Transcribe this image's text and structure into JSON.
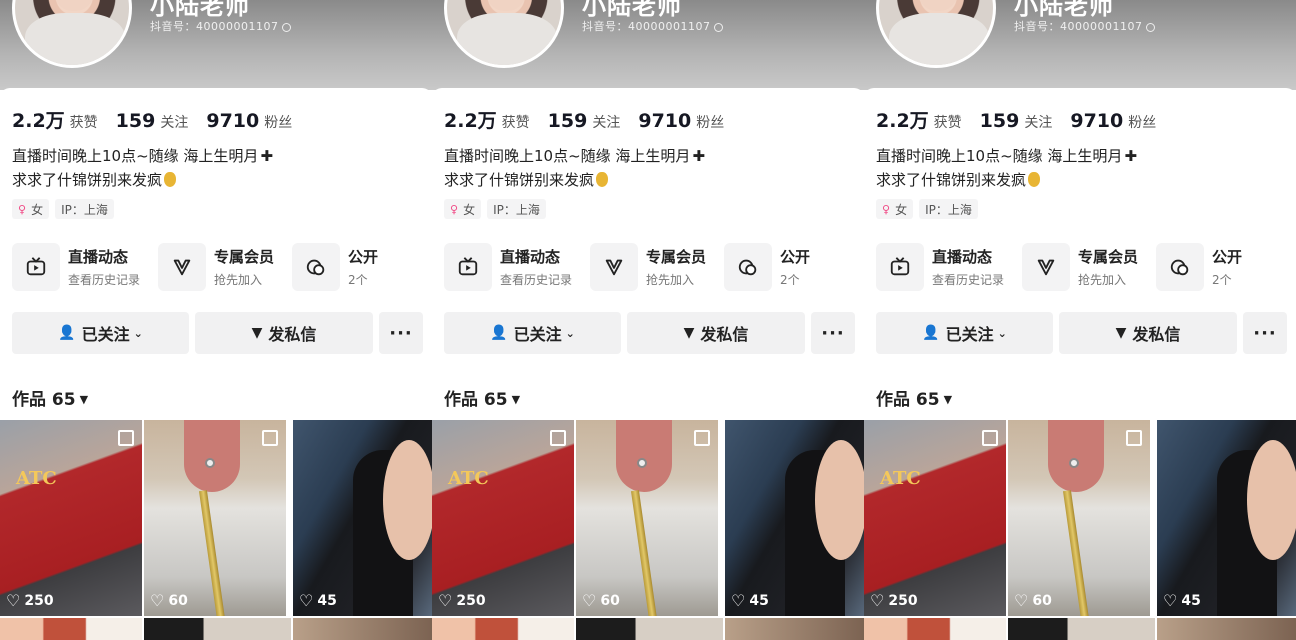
{
  "panels": [
    {
      "profile": {
        "nickname": "小陆老师",
        "douyin_id": "抖音号：40000001107"
      },
      "stats": [
        {
          "value": "2.2万",
          "label": "获赞"
        },
        {
          "value": "159",
          "label": "关注"
        },
        {
          "value": "9710",
          "label": "粉丝"
        }
      ],
      "bio": {
        "line1": "直播时间晚上10点~随缘 海上生明月",
        "line2": "求求了什锦饼别来发疯"
      },
      "tags": {
        "gender": "女",
        "ip": "IP：上海"
      },
      "services": [
        {
          "title": "直播动态",
          "subtitle": "查看历史记录"
        },
        {
          "title": "专属会员",
          "subtitle": "抢先加入"
        },
        {
          "title": "公开",
          "subtitle": "2个"
        }
      ],
      "actions": {
        "follow": "已关注",
        "message": "发私信",
        "more": "···"
      },
      "works": {
        "label": "作品 65"
      },
      "videos": [
        {
          "likes": "250",
          "overlay": "ATC"
        },
        {
          "likes": "60"
        },
        {
          "likes": "45"
        }
      ]
    },
    {
      "profile": {
        "nickname": "小陆老师",
        "douyin_id": "抖音号：40000001107"
      },
      "stats": [
        {
          "value": "2.2万",
          "label": "获赞"
        },
        {
          "value": "159",
          "label": "关注"
        },
        {
          "value": "9710",
          "label": "粉丝"
        }
      ],
      "bio": {
        "line1": "直播时间晚上10点~随缘 海上生明月",
        "line2": "求求了什锦饼别来发疯"
      },
      "tags": {
        "gender": "女",
        "ip": "IP：上海"
      },
      "services": [
        {
          "title": "直播动态",
          "subtitle": "查看历史记录"
        },
        {
          "title": "专属会员",
          "subtitle": "抢先加入"
        },
        {
          "title": "公开",
          "subtitle": "2个"
        }
      ],
      "actions": {
        "follow": "已关注",
        "message": "发私信",
        "more": "···"
      },
      "works": {
        "label": "作品 65"
      },
      "videos": [
        {
          "likes": "250",
          "overlay": "ATC"
        },
        {
          "likes": "60"
        },
        {
          "likes": "45"
        }
      ]
    },
    {
      "profile": {
        "nickname": "小陆老师",
        "douyin_id": "抖音号：40000001107"
      },
      "stats": [
        {
          "value": "2.2万",
          "label": "获赞"
        },
        {
          "value": "159",
          "label": "关注"
        },
        {
          "value": "9710",
          "label": "粉丝"
        }
      ],
      "bio": {
        "line1": "直播时间晚上10点~随缘 海上生明月",
        "line2": "求求了什锦饼别来发疯"
      },
      "tags": {
        "gender": "女",
        "ip": "IP：上海"
      },
      "services": [
        {
          "title": "直播动态",
          "subtitle": "查看历史记录"
        },
        {
          "title": "专属会员",
          "subtitle": "抢先加入"
        },
        {
          "title": "公开",
          "subtitle": "2个"
        }
      ],
      "actions": {
        "follow": "已关注",
        "message": "发私信",
        "more": "···"
      },
      "works": {
        "label": "作品 65"
      },
      "videos": [
        {
          "likes": "250",
          "overlay": "ATC"
        },
        {
          "likes": "60"
        },
        {
          "likes": "45"
        }
      ]
    }
  ]
}
